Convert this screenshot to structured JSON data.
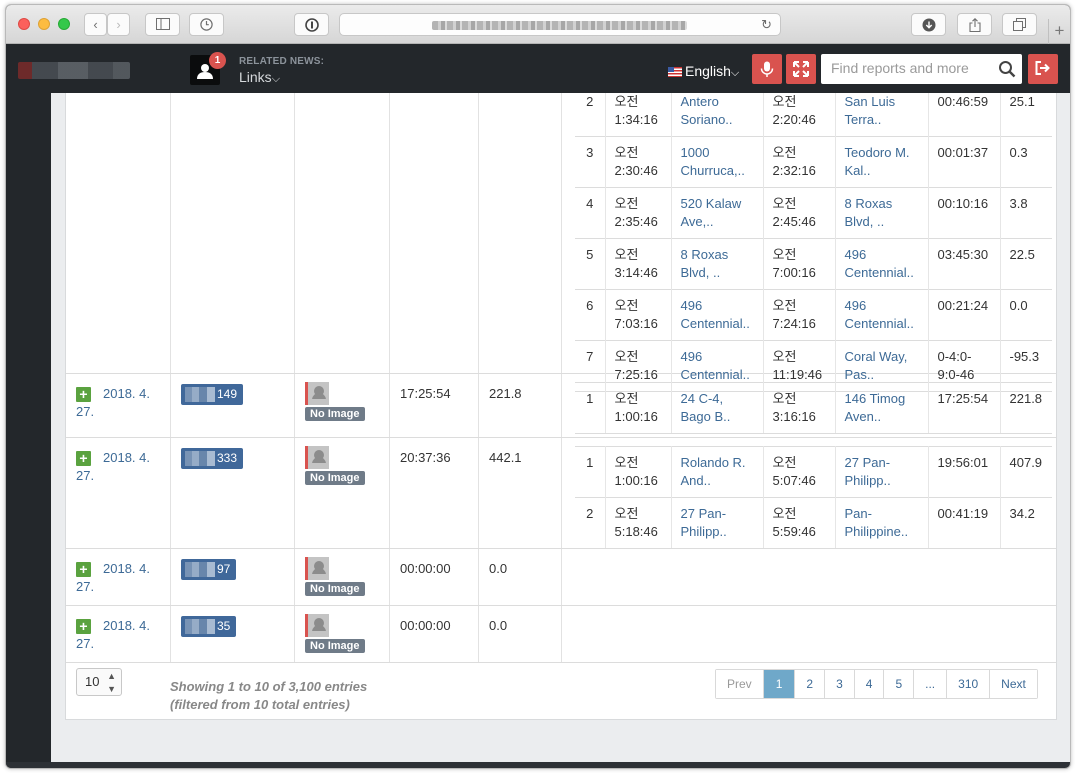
{
  "browser": {
    "back": "‹",
    "forward": "›",
    "new_tab": "+"
  },
  "nav": {
    "notification_count": "1",
    "related_label": "RELATED NEWS:",
    "related_value": "Links",
    "language": "English",
    "search_placeholder": "Find reports and more"
  },
  "rows": [
    {
      "trips": [
        {
          "no": "2",
          "start_time_l1": "오전",
          "start_time_l2": "1:34:16",
          "start_loc": "Antero Soriano..",
          "end_time_l1": "오전",
          "end_time_l2": "2:20:46",
          "end_loc": "San Luis Terra..",
          "duration": "00:46:59",
          "distance": "25.1"
        },
        {
          "no": "3",
          "start_time_l1": "오전",
          "start_time_l2": "2:30:46",
          "start_loc": "1000 Churruca,..",
          "end_time_l1": "오전",
          "end_time_l2": "2:32:16",
          "end_loc": "Teodoro M. Kal..",
          "duration": "00:01:37",
          "distance": "0.3"
        },
        {
          "no": "4",
          "start_time_l1": "오전",
          "start_time_l2": "2:35:46",
          "start_loc": "520 Kalaw Ave,..",
          "end_time_l1": "오전",
          "end_time_l2": "2:45:46",
          "end_loc": "8 Roxas Blvd, ..",
          "duration": "00:10:16",
          "distance": "3.8"
        },
        {
          "no": "5",
          "start_time_l1": "오전",
          "start_time_l2": "3:14:46",
          "start_loc": "8 Roxas Blvd, ..",
          "end_time_l1": "오전",
          "end_time_l2": "7:00:16",
          "end_loc": "496 Centennial..",
          "duration": "03:45:30",
          "distance": "22.5"
        },
        {
          "no": "6",
          "start_time_l1": "오전",
          "start_time_l2": "7:03:16",
          "start_loc": "496 Centennial..",
          "end_time_l1": "오전",
          "end_time_l2": "7:24:16",
          "end_loc": "496 Centennial..",
          "duration": "00:21:24",
          "distance": "0.0"
        },
        {
          "no": "7",
          "start_time_l1": "오전",
          "start_time_l2": "7:25:16",
          "start_loc": "496 Centennial..",
          "end_time_l1": "오전",
          "end_time_l2": "11:19:46",
          "end_loc": "Coral Way, Pas..",
          "duration": "0-4:0-9:0-46",
          "distance": "-95.3"
        }
      ]
    },
    {
      "date": "2018. 4. 27.",
      "id_suffix": "149",
      "no_image": "No Image",
      "duration": "17:25:54",
      "distance": "221.8",
      "trips": [
        {
          "no": "1",
          "start_time_l1": "오전",
          "start_time_l2": "1:00:16",
          "start_loc": "24 C-4, Bago B..",
          "end_time_l1": "오전",
          "end_time_l2": "3:16:16",
          "end_loc": "146 Timog Aven..",
          "duration": "17:25:54",
          "distance": "221.8"
        }
      ]
    },
    {
      "date": "2018. 4. 27.",
      "id_suffix": "333",
      "no_image": "No Image",
      "duration": "20:37:36",
      "distance": "442.1",
      "trips": [
        {
          "no": "1",
          "start_time_l1": "오전",
          "start_time_l2": "1:00:16",
          "start_loc": "Rolando R. And..",
          "end_time_l1": "오전",
          "end_time_l2": "5:07:46",
          "end_loc": "27 Pan-Philipp..",
          "duration": "19:56:01",
          "distance": "407.9"
        },
        {
          "no": "2",
          "start_time_l1": "오전",
          "start_time_l2": "5:18:46",
          "start_loc": "27 Pan-Philipp..",
          "end_time_l1": "오전",
          "end_time_l2": "5:59:46",
          "end_loc": "Pan-Philippine..",
          "duration": "00:41:19",
          "distance": "34.2"
        }
      ]
    },
    {
      "date": "2018. 4. 27.",
      "id_suffix": "97",
      "no_image": "No Image",
      "duration": "00:00:00",
      "distance": "0.0",
      "trips": []
    },
    {
      "date": "2018. 4. 27.",
      "id_suffix": "35",
      "no_image": "No Image",
      "duration": "00:00:00",
      "distance": "0.0",
      "trips": []
    }
  ],
  "footer": {
    "page_length": "10",
    "info_line1": "Showing 1 to 10 of 3,100 entries",
    "info_line2": "(filtered from 10 total entries)",
    "pagination": [
      "Prev",
      "1",
      "2",
      "3",
      "4",
      "5",
      "...",
      "310",
      "Next"
    ],
    "active_page": "1"
  },
  "colors": {
    "link": "#3d6a96",
    "danger": "#d9534f",
    "active_page": "#6fa8c9",
    "navbar": "#23272b",
    "plus": "#5aa23f"
  }
}
